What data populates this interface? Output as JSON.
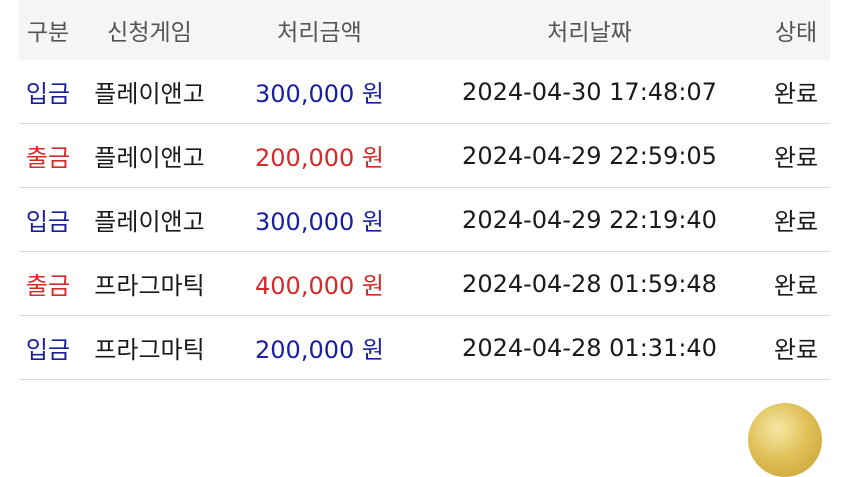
{
  "headers": {
    "type": "구분",
    "game": "신청게임",
    "amount": "처리금액",
    "date": "처리날짜",
    "status": "상태"
  },
  "rows": [
    {
      "type": "입금",
      "kind": "deposit",
      "game": "플레이앤고",
      "amount": "300,000 원",
      "date": "2024-04-30 17:48:07",
      "status": "완료"
    },
    {
      "type": "출금",
      "kind": "withdraw",
      "game": "플레이앤고",
      "amount": "200,000 원",
      "date": "2024-04-29 22:59:05",
      "status": "완료"
    },
    {
      "type": "입금",
      "kind": "deposit",
      "game": "플레이앤고",
      "amount": "300,000 원",
      "date": "2024-04-29 22:19:40",
      "status": "완료"
    },
    {
      "type": "출금",
      "kind": "withdraw",
      "game": "프라그마틱",
      "amount": "400,000 원",
      "date": "2024-04-28 01:59:48",
      "status": "완료"
    },
    {
      "type": "입금",
      "kind": "deposit",
      "game": "프라그마틱",
      "amount": "200,000 원",
      "date": "2024-04-28 01:31:40",
      "status": "완료"
    }
  ],
  "colors": {
    "deposit": "#1a1fa0",
    "withdraw": "#d42a2a",
    "header_bg": "#f5f5f5",
    "divider": "#d9d9d9"
  }
}
